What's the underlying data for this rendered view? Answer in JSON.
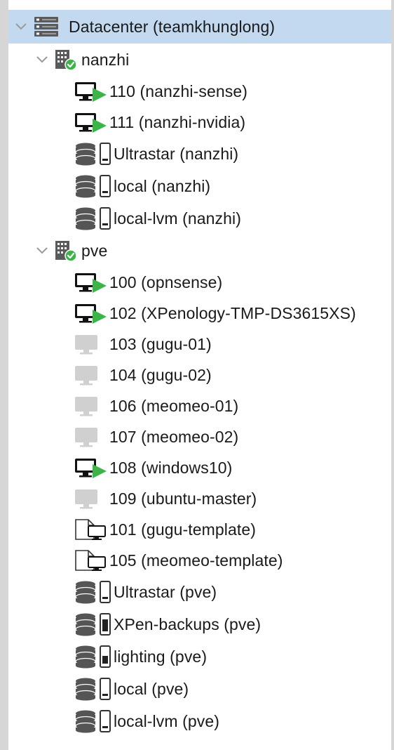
{
  "tree": {
    "datacenter": {
      "label": "Datacenter (teamkhunglong)",
      "icon": "datacenter-server-icon",
      "expanded": true,
      "selected": true
    },
    "nodes": [
      {
        "label": "nanzhi",
        "icon": "node-online-icon",
        "expanded": true,
        "children": [
          {
            "label": "110 (nanzhi-sense)",
            "type": "vm",
            "status": "running"
          },
          {
            "label": "111 (nanzhi-nvidia)",
            "type": "vm",
            "status": "running"
          },
          {
            "label": "Ultrastar (nanzhi)",
            "type": "storage",
            "usage": 0.15
          },
          {
            "label": "local (nanzhi)",
            "type": "storage",
            "usage": 0.15
          },
          {
            "label": "local-lvm (nanzhi)",
            "type": "storage",
            "usage": 0.15
          }
        ]
      },
      {
        "label": "pve",
        "icon": "node-online-icon",
        "expanded": true,
        "children": [
          {
            "label": "100 (opnsense)",
            "type": "vm",
            "status": "running"
          },
          {
            "label": "102 (XPenology-TMP-DS3615XS)",
            "type": "vm",
            "status": "running"
          },
          {
            "label": "103 (gugu-01)",
            "type": "vm",
            "status": "stopped"
          },
          {
            "label": "104 (gugu-02)",
            "type": "vm",
            "status": "stopped"
          },
          {
            "label": "106 (meomeo-01)",
            "type": "vm",
            "status": "stopped"
          },
          {
            "label": "107 (meomeo-02)",
            "type": "vm",
            "status": "stopped"
          },
          {
            "label": "108 (windows10)",
            "type": "vm",
            "status": "running"
          },
          {
            "label": "109 (ubuntu-master)",
            "type": "vm",
            "status": "stopped"
          },
          {
            "label": "101 (gugu-template)",
            "type": "template"
          },
          {
            "label": "105 (meomeo-template)",
            "type": "template"
          },
          {
            "label": "Ultrastar (pve)",
            "type": "storage",
            "usage": 0.15
          },
          {
            "label": "XPen-backups (pve)",
            "type": "storage",
            "usage": 0.75
          },
          {
            "label": "lighting (pve)",
            "type": "storage",
            "usage": 0.5
          },
          {
            "label": "local (pve)",
            "type": "storage",
            "usage": 0.15
          },
          {
            "label": "local-lvm (pve)",
            "type": "storage",
            "usage": 0.15
          }
        ]
      }
    ]
  },
  "colors": {
    "selection": "#c3d9ef",
    "running": "#3db34a",
    "stopped_vm": "#d0d0d0",
    "node_ok": "#3db34a",
    "text": "#1a1a1a",
    "frame": "#d6d6d6"
  }
}
